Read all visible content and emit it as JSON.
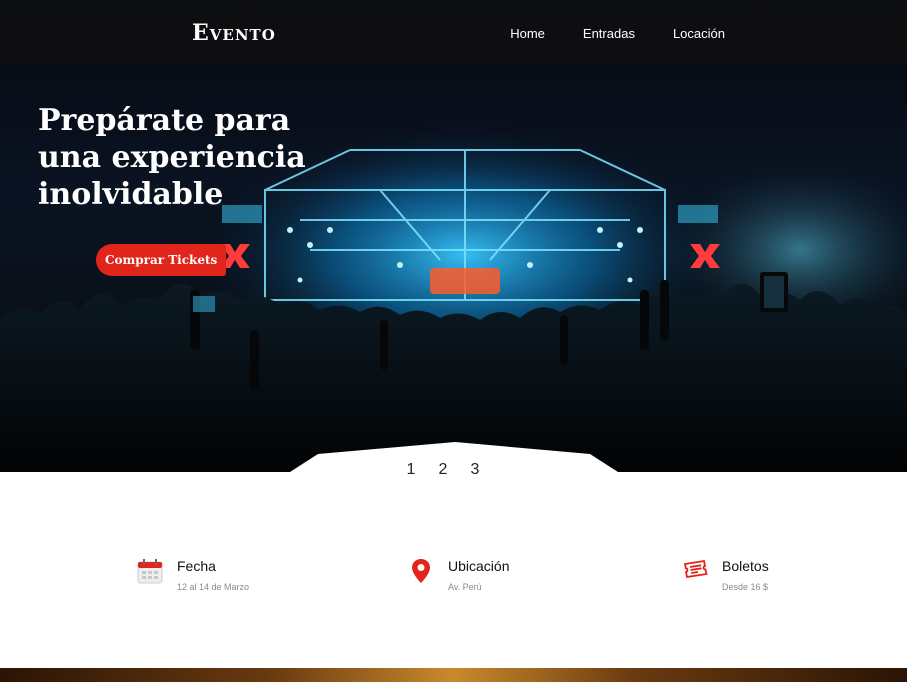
{
  "header": {
    "logo": "Evento",
    "nav": [
      {
        "label": "Home"
      },
      {
        "label": "Entradas"
      },
      {
        "label": "Locación"
      }
    ]
  },
  "hero": {
    "title_lines": [
      "Prepárate para",
      "una experiencia",
      "inolvidable"
    ],
    "cta_label": "Comprar Tickets"
  },
  "slider": {
    "pages": [
      "1",
      "2",
      "3"
    ]
  },
  "info": {
    "fecha": {
      "label": "Fecha",
      "value": "12 al 14 de Marzo",
      "icon": "calendar-icon"
    },
    "ubicacion": {
      "label": "Ubicación",
      "value": "Av. Perú",
      "icon": "location-pin-icon"
    },
    "boletos": {
      "label": "Boletos",
      "value": "Desde 16 $",
      "icon": "ticket-icon"
    }
  },
  "colors": {
    "accent": "#e1251b",
    "nav_bg": "#121214",
    "text_dark": "#111111",
    "text_muted": "#8a8a8a"
  }
}
